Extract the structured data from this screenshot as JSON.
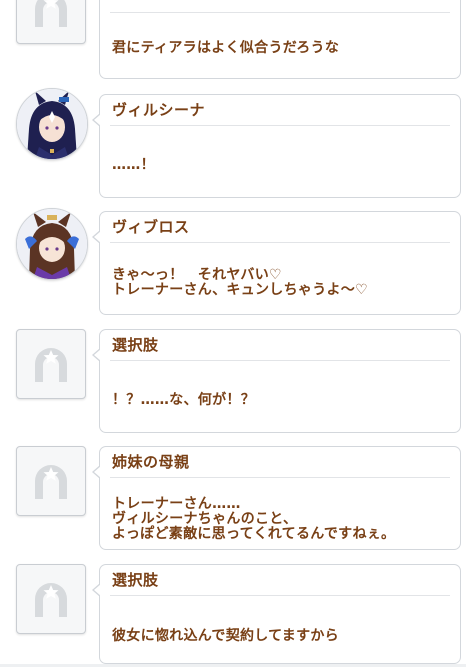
{
  "entries": [
    {
      "speaker": "",
      "avatar": "placeholder-horseshoe-icon",
      "text": "君にティアラはよく似合うだろうな"
    },
    {
      "speaker": "ヴィルシーナ",
      "avatar": "character-portrait-vilshina",
      "text": "……！"
    },
    {
      "speaker": "ヴィブロス",
      "avatar": "character-portrait-vivlos",
      "text": "きゃ～っ！　それヤバい♡\nトレーナーさん、キュンしちゃうよ～♡"
    },
    {
      "speaker": "選択肢",
      "avatar": "placeholder-horseshoe-icon",
      "text": "！？……な、何が！？"
    },
    {
      "speaker": "姉妹の母親",
      "avatar": "placeholder-horseshoe-icon",
      "text": "トレーナーさん……\nヴィルシーナちゃんのこと、\nよっぽど素敵に思ってくれてるんですねぇ。"
    },
    {
      "speaker": "選択肢",
      "avatar": "placeholder-horseshoe-icon",
      "text": "彼女に惚れ込んで契約してますから"
    }
  ],
  "colors": {
    "text": "#794016",
    "bubble_border": "#d3d7dc",
    "background": "#ffffff"
  }
}
